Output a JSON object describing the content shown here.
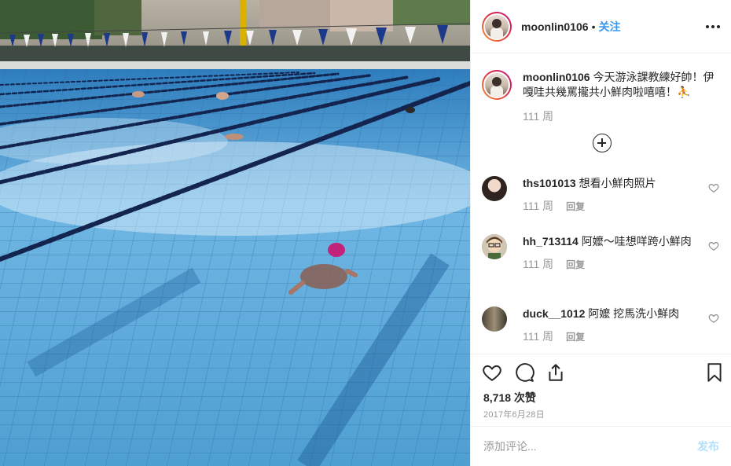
{
  "post": {
    "username": "moonlin0106",
    "dot": "•",
    "follow_label": "关注"
  },
  "caption": {
    "username": "moonlin0106",
    "text": "今天游泳課教練好帥！伊嘎哇共幾罵攏共小鮮肉啦嘻嘻！⛹",
    "time": "111 周"
  },
  "comments": [
    {
      "username": "ths101013",
      "text": "想看小鮮肉照片",
      "time": "111 周",
      "reply_label": "回复"
    },
    {
      "username": "hh_713114",
      "text": "阿嬤～哇想咩跨小鮮肉",
      "time": "111 周",
      "reply_label": "回复"
    },
    {
      "username": "duck__1012",
      "text": "阿嬤 挖馬洗小鮮肉",
      "time": "111 周",
      "reply_label": "回复"
    }
  ],
  "stats": {
    "likes": "8,718 次赞",
    "date": "2017年6月28日"
  },
  "add_comment": {
    "placeholder": "添加评论...",
    "post_label": "发布"
  },
  "icons": {
    "more": "more-horizontal-icon",
    "load_more": "plus-circle-icon",
    "like": "heart-icon",
    "comment": "speech-bubble-icon",
    "share": "share-icon",
    "save": "bookmark-icon"
  },
  "colors": {
    "accent": "#3897f0",
    "muted": "#999999",
    "post_disabled": "#b2dffc"
  }
}
